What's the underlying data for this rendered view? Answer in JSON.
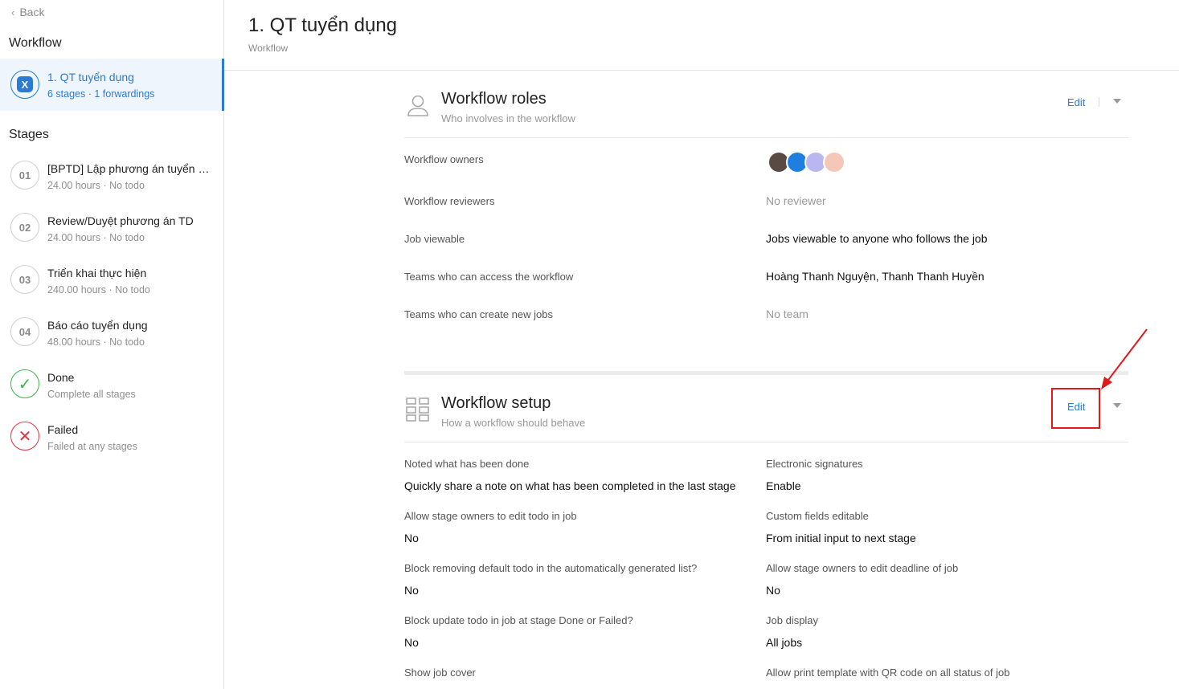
{
  "sidebar": {
    "back_label": "Back",
    "workflow_heading": "Workflow",
    "workflow_item": {
      "title": "1. QT tuyển dụng",
      "subtitle": "6 stages · 1 forwardings"
    },
    "stages_heading": "Stages",
    "stages": [
      {
        "num": "01",
        "title": "[BPTD] Lập phương án tuyển dụng",
        "meta": "24.00 hours · No todo"
      },
      {
        "num": "02",
        "title": "Review/Duyệt phương án TD",
        "meta": "24.00 hours · No todo"
      },
      {
        "num": "03",
        "title": "Triển khai thực hiện",
        "meta": "240.00 hours · No todo"
      },
      {
        "num": "04",
        "title": "Báo cáo tuyển dụng",
        "meta": "48.00 hours · No todo"
      },
      {
        "num": "✓",
        "title": "Done",
        "meta": "Complete all stages"
      },
      {
        "num": "✕",
        "title": "Failed",
        "meta": "Failed at any stages"
      }
    ]
  },
  "header": {
    "title": "1. QT tuyển dụng",
    "crumb": "Workflow"
  },
  "roles": {
    "title": "Workflow roles",
    "subtitle": "Who involves in the workflow",
    "edit_label": "Edit",
    "rows": [
      {
        "label": "Workflow owners",
        "value": ""
      },
      {
        "label": "Workflow reviewers",
        "value": "No reviewer"
      },
      {
        "label": "Job viewable",
        "value": "Jobs viewable to anyone who follows the job"
      },
      {
        "label": "Teams who can access the workflow",
        "value": "Hoàng Thanh Nguyện, Thanh Thanh Huyền"
      },
      {
        "label": "Teams who can create new jobs",
        "value": "No team"
      }
    ]
  },
  "setup": {
    "title": "Workflow setup",
    "subtitle": "How a workflow should behave",
    "edit_label": "Edit",
    "left": [
      {
        "label": "Noted what has been done",
        "value": "Quickly share a note on what has been completed in the last stage"
      },
      {
        "label": "Allow stage owners to edit todo in job",
        "value": "No"
      },
      {
        "label": "Block removing default todo in the automatically generated list?",
        "value": "No"
      },
      {
        "label": "Block update todo in job at stage Done or Failed?",
        "value": "No"
      },
      {
        "label": "Show job cover",
        "value": ""
      }
    ],
    "right": [
      {
        "label": "Electronic signatures",
        "value": "Enable"
      },
      {
        "label": "Custom fields editable",
        "value": "From initial input to next stage"
      },
      {
        "label": "Allow stage owners to edit deadline of job",
        "value": "No"
      },
      {
        "label": "Job display",
        "value": "All jobs"
      },
      {
        "label": "Allow print template with QR code on all status of job",
        "value": ""
      }
    ]
  },
  "colors": {
    "accent": "#2b7bd3",
    "done": "#3bb54a",
    "failed": "#d9363e",
    "annotation": "#e0191b"
  }
}
